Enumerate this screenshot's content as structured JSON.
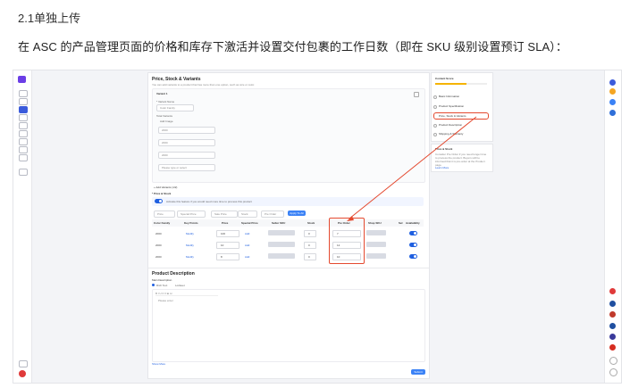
{
  "heading": "2.1单独上传",
  "description": "在 ASC 的产品管理页面的价格和库存下激活并设置交付包裹的工作日数（即在 SKU 级别设置预订 SLA）：",
  "screenshot": {
    "section_title": "Price, Stock & Variants",
    "section_subtitle": "You can add variants to a product that has more than one option, such as size or color.",
    "variant_label": "Variant 1",
    "variant_name_label": "* Variant Name",
    "variant_name_value": "Color Family",
    "total_variants_label": "Total Variants",
    "add_image_label": "Add Image",
    "variant_values": [
      "2000",
      "2000",
      "2000"
    ],
    "add_variant_placeholder": "Please type or select",
    "add_variant_button": "+ Add Variants (1/2)",
    "price_stock_label": "* Price & Stock",
    "preorder_note": "Activate this feature if you would need more time to process this product",
    "filter_placeholders": [
      "Price",
      "Special Price",
      "Sale Price",
      "Stock",
      "Pre Order"
    ],
    "apply_button": "Apply To All",
    "columns": [
      "Color Family",
      "Key Points",
      "Price",
      "Special Price",
      "Seller SKU",
      "Stock",
      "Pre Order",
      "Shop SKU",
      "Sel",
      "Availability"
    ],
    "rows": [
      {
        "color": "2000",
        "key": "Modify",
        "price": "100",
        "special": "Add",
        "stock": "0",
        "preorder": "7"
      },
      {
        "color": "2000",
        "key": "Modify",
        "price": "10",
        "special": "Add",
        "stock": "0",
        "preorder": "12"
      },
      {
        "color": "2000",
        "key": "Modify",
        "price": "8",
        "special": "Add",
        "stock": "0",
        "preorder": "10"
      }
    ],
    "product_description_title": "Product Description",
    "main_description_label": "Main Description",
    "editor_tabs": [
      "Rich Text",
      "Lorikeet"
    ],
    "editor_placeholder": "Please enter",
    "show_more": "Show More",
    "submit_button": "Submit",
    "content_score": {
      "title": "Content Score",
      "items": [
        "Basic Information",
        "Product Specification",
        "Price, Stock & Variants",
        "Product Description",
        "Shipping & Warranty"
      ]
    },
    "tip": {
      "title": "Price & Stock",
      "text": "Consider Pre Order if you need longer time to process the product. Buyers will be informed that it is pre-order at the Product page.",
      "link": "Learn More"
    }
  },
  "colors": {
    "accent": "#1f5fe0",
    "highlight": "#e4492f"
  }
}
